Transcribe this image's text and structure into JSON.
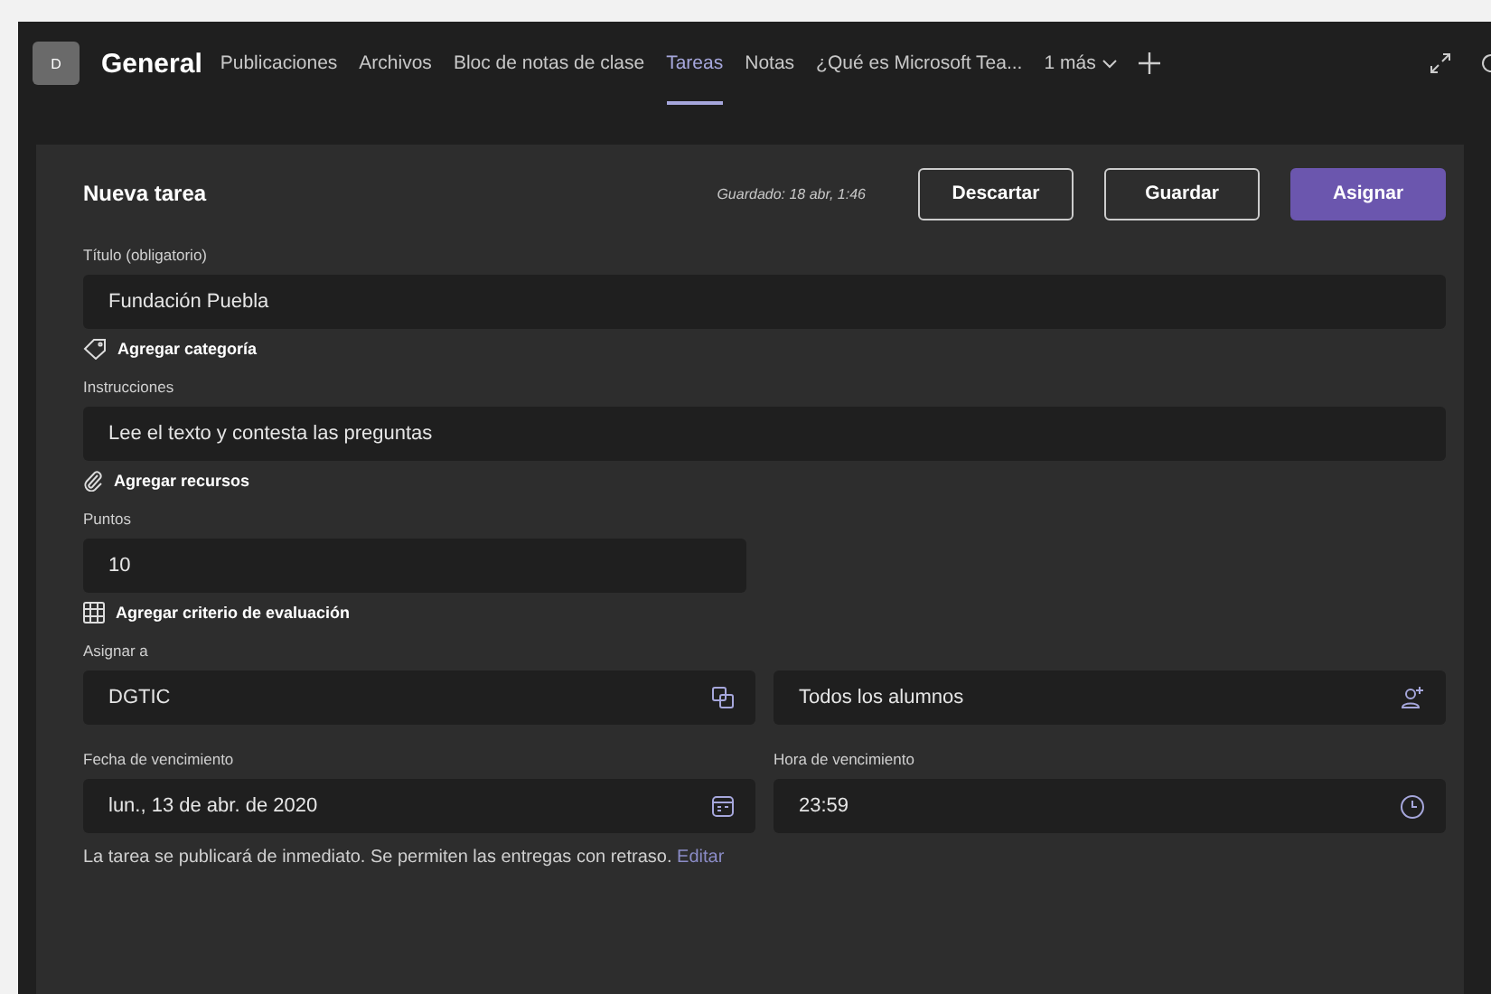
{
  "header": {
    "avatar": "D",
    "channel": "General",
    "tabs": [
      {
        "label": "Publicaciones",
        "selected": false
      },
      {
        "label": "Archivos",
        "selected": false
      },
      {
        "label": "Bloc de notas de clase",
        "selected": false
      },
      {
        "label": "Tareas",
        "selected": true
      },
      {
        "label": "Notas",
        "selected": false
      },
      {
        "label": "¿Qué es Microsoft Tea...",
        "selected": false
      }
    ],
    "more": "1 más"
  },
  "editor": {
    "title": "Nueva tarea",
    "saved": "Guardado: 18 abr, 1:46",
    "buttons": [
      {
        "label": "Descartar",
        "kind": "secondary"
      },
      {
        "label": "Guardar",
        "kind": "secondary"
      },
      {
        "label": "Asignar",
        "kind": "primary"
      }
    ],
    "title_field": {
      "label": "Título (obligatorio)",
      "value": "Fundación Puebla"
    },
    "add_category": "Agregar categoría",
    "instructions": {
      "label": "Instrucciones",
      "value": "Lee el texto y contesta las preguntas"
    },
    "add_resources": "Agregar recursos",
    "points": {
      "label": "Puntos",
      "value": "10"
    },
    "add_rubric": "Agregar criterio de evaluación",
    "assign_to": {
      "label": "Asignar a",
      "class_value": "DGTIC",
      "students_value": "Todos los alumnos"
    },
    "due_date": {
      "label": "Fecha de vencimiento",
      "value": "lun., 13 de abr. de 2020"
    },
    "due_time": {
      "label": "Hora de vencimiento",
      "value": "23:59"
    },
    "notice": {
      "text": "La tarea se publicará de inmediato. Se permiten las entregas con retraso.",
      "link": "Editar"
    }
  }
}
